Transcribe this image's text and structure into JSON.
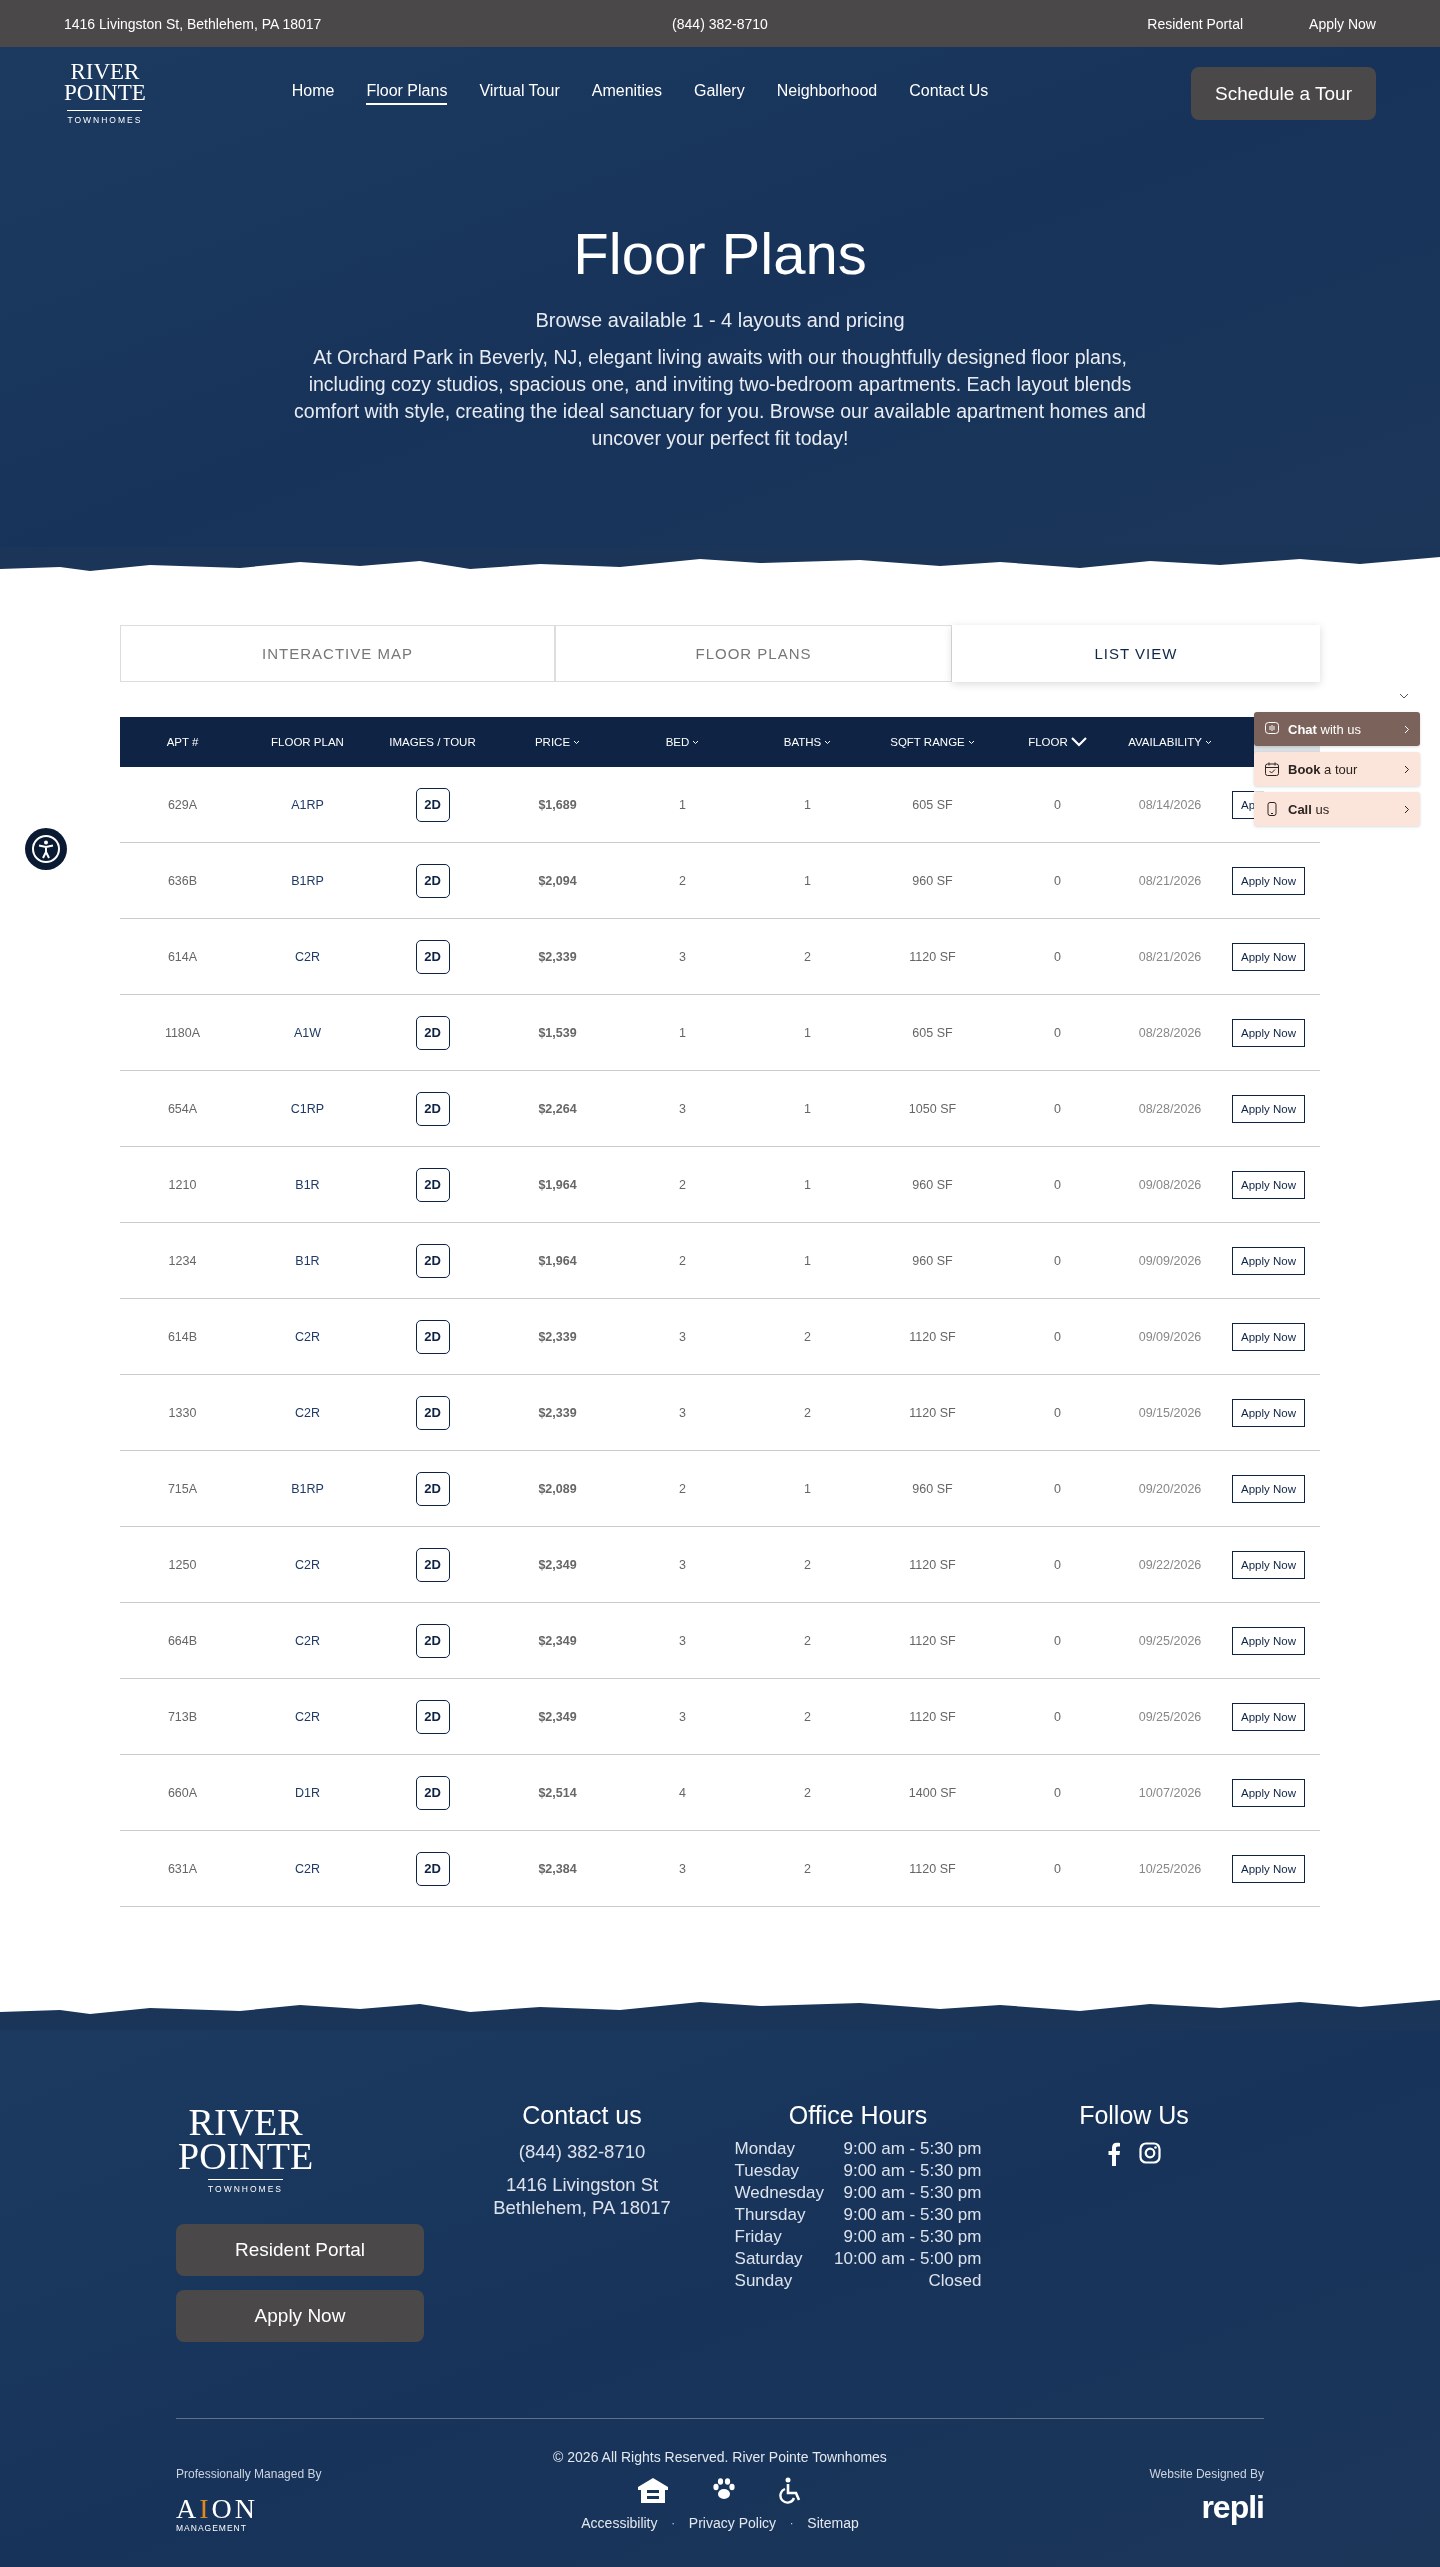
{
  "top_bar": {
    "address": "1416 Livingston St, Bethlehem, PA 18017",
    "phone": "(844) 382-8710",
    "links": [
      "Resident Portal",
      "Apply Now"
    ]
  },
  "nav": {
    "logo": {
      "line1": "RIVER",
      "line2": "POINTE",
      "line3": "TOWNHOMES"
    },
    "items": [
      {
        "label": "Home",
        "selected": false
      },
      {
        "label": "Floor Plans",
        "selected": true
      },
      {
        "label": "Virtual Tour",
        "selected": false
      },
      {
        "label": "Amenities",
        "selected": false
      },
      {
        "label": "Gallery",
        "selected": false
      },
      {
        "label": "Neighborhood",
        "selected": false
      },
      {
        "label": "Contact Us",
        "selected": false
      }
    ],
    "cta": "Schedule a Tour"
  },
  "hero": {
    "title": "Floor Plans",
    "subtitle": "Browse available 1 - 4 layouts and pricing",
    "body": "At Orchard Park in Beverly, NJ, elegant living awaits with our thoughtfully designed floor plans, including cozy studios, spacious one, and inviting two-bedroom apartments. Each layout blends comfort with style, creating the ideal sanctuary for you. Browse our available apartment homes and uncover your perfect fit today!"
  },
  "view_tabs": [
    {
      "label": "INTERACTIVE MAP",
      "selected": false
    },
    {
      "label": "FLOOR PLANS",
      "selected": false
    },
    {
      "label": "LIST VIEW",
      "selected": true
    }
  ],
  "table": {
    "columns": [
      {
        "label": "APT #",
        "kind": "plain"
      },
      {
        "label": "FLOOR PLAN",
        "kind": "plain"
      },
      {
        "label": "IMAGES / TOUR",
        "kind": "plain"
      },
      {
        "label": "PRICE",
        "kind": "sortable"
      },
      {
        "label": "BED",
        "kind": "sortable"
      },
      {
        "label": "BATHS",
        "kind": "sortable"
      },
      {
        "label": "SQFT RANGE",
        "kind": "sortable"
      },
      {
        "label": "FLOOR",
        "kind": "sorted"
      },
      {
        "label": "AVAILABILITY",
        "kind": "sortable"
      }
    ],
    "rows": [
      {
        "apt": "629A",
        "plan": "A1RP",
        "tour": "2D",
        "price": "$1,689",
        "bed": "1",
        "baths": "1",
        "sqft": "605 SF",
        "floor": "0",
        "available": "08/14/2026",
        "action": "Ap"
      },
      {
        "apt": "636B",
        "plan": "B1RP",
        "tour": "2D",
        "price": "$2,094",
        "bed": "2",
        "baths": "1",
        "sqft": "960 SF",
        "floor": "0",
        "available": "08/21/2026",
        "action": "Apply Now"
      },
      {
        "apt": "614A",
        "plan": "C2R",
        "tour": "2D",
        "price": "$2,339",
        "bed": "3",
        "baths": "2",
        "sqft": "1120 SF",
        "floor": "0",
        "available": "08/21/2026",
        "action": "Apply Now"
      },
      {
        "apt": "1180A",
        "plan": "A1W",
        "tour": "2D",
        "price": "$1,539",
        "bed": "1",
        "baths": "1",
        "sqft": "605 SF",
        "floor": "0",
        "available": "08/28/2026",
        "action": "Apply Now"
      },
      {
        "apt": "654A",
        "plan": "C1RP",
        "tour": "2D",
        "price": "$2,264",
        "bed": "3",
        "baths": "1",
        "sqft": "1050 SF",
        "floor": "0",
        "available": "08/28/2026",
        "action": "Apply Now"
      },
      {
        "apt": "1210",
        "plan": "B1R",
        "tour": "2D",
        "price": "$1,964",
        "bed": "2",
        "baths": "1",
        "sqft": "960 SF",
        "floor": "0",
        "available": "09/08/2026",
        "action": "Apply Now"
      },
      {
        "apt": "1234",
        "plan": "B1R",
        "tour": "2D",
        "price": "$1,964",
        "bed": "2",
        "baths": "1",
        "sqft": "960 SF",
        "floor": "0",
        "available": "09/09/2026",
        "action": "Apply Now"
      },
      {
        "apt": "614B",
        "plan": "C2R",
        "tour": "2D",
        "price": "$2,339",
        "bed": "3",
        "baths": "2",
        "sqft": "1120 SF",
        "floor": "0",
        "available": "09/09/2026",
        "action": "Apply Now"
      },
      {
        "apt": "1330",
        "plan": "C2R",
        "tour": "2D",
        "price": "$2,339",
        "bed": "3",
        "baths": "2",
        "sqft": "1120 SF",
        "floor": "0",
        "available": "09/15/2026",
        "action": "Apply Now"
      },
      {
        "apt": "715A",
        "plan": "B1RP",
        "tour": "2D",
        "price": "$2,089",
        "bed": "2",
        "baths": "1",
        "sqft": "960 SF",
        "floor": "0",
        "available": "09/20/2026",
        "action": "Apply Now"
      },
      {
        "apt": "1250",
        "plan": "C2R",
        "tour": "2D",
        "price": "$2,349",
        "bed": "3",
        "baths": "2",
        "sqft": "1120 SF",
        "floor": "0",
        "available": "09/22/2026",
        "action": "Apply Now"
      },
      {
        "apt": "664B",
        "plan": "C2R",
        "tour": "2D",
        "price": "$2,349",
        "bed": "3",
        "baths": "2",
        "sqft": "1120 SF",
        "floor": "0",
        "available": "09/25/2026",
        "action": "Apply Now"
      },
      {
        "apt": "713B",
        "plan": "C2R",
        "tour": "2D",
        "price": "$2,349",
        "bed": "3",
        "baths": "2",
        "sqft": "1120 SF",
        "floor": "0",
        "available": "09/25/2026",
        "action": "Apply Now"
      },
      {
        "apt": "660A",
        "plan": "D1R",
        "tour": "2D",
        "price": "$2,514",
        "bed": "4",
        "baths": "2",
        "sqft": "1400 SF",
        "floor": "0",
        "available": "10/07/2026",
        "action": "Apply Now"
      },
      {
        "apt": "631A",
        "plan": "C2R",
        "tour": "2D",
        "price": "$2,384",
        "bed": "3",
        "baths": "2",
        "sqft": "1120 SF",
        "floor": "0",
        "available": "10/25/2026",
        "action": "Apply Now"
      }
    ]
  },
  "chat_widget": {
    "items": [
      {
        "kind": "chat",
        "label": "**Chat** with us",
        "selected": true
      },
      {
        "kind": "tour",
        "label": "**Book** a tour",
        "selected": false
      },
      {
        "kind": "call",
        "label": "**Call** us",
        "selected": false
      }
    ]
  },
  "footer": {
    "logo": {
      "line1": "RIVER",
      "line2": "POINTE",
      "line3": "TOWNHOMES"
    },
    "buttons": [
      "Resident Portal",
      "Apply Now"
    ],
    "contact": {
      "title": "Contact us",
      "phone": "(844) 382-8710",
      "address_line1": "1416 Livingston St",
      "address_line2": "Bethlehem, PA 18017"
    },
    "hours": {
      "title": "Office Hours",
      "days": [
        {
          "day": "Monday",
          "hours": "9:00 am - 5:30 pm"
        },
        {
          "day": "Tuesday",
          "hours": "9:00 am - 5:30 pm"
        },
        {
          "day": "Wednesday",
          "hours": "9:00 am - 5:30 pm"
        },
        {
          "day": "Thursday",
          "hours": "9:00 am - 5:30 pm"
        },
        {
          "day": "Friday",
          "hours": "9:00 am - 5:30 pm"
        },
        {
          "day": "Saturday",
          "hours": "10:00 am - 5:00 pm"
        },
        {
          "day": "Sunday",
          "hours": "Closed"
        }
      ]
    },
    "follow": {
      "title": "Follow Us"
    },
    "managed_by": {
      "label": "Professionally Managed By",
      "logo_pre": "A",
      "logo_mark": "I",
      "logo_post": "ON",
      "logo_sub": "MANAGEMENT"
    },
    "copyright": "© 2026 All Rights Reserved. River Pointe Townhomes",
    "links": [
      "Accessibility",
      "Privacy Policy",
      "Sitemap"
    ],
    "link_separator": "·",
    "designed_by": {
      "label": "Website Designed By",
      "logo": "repli"
    }
  }
}
